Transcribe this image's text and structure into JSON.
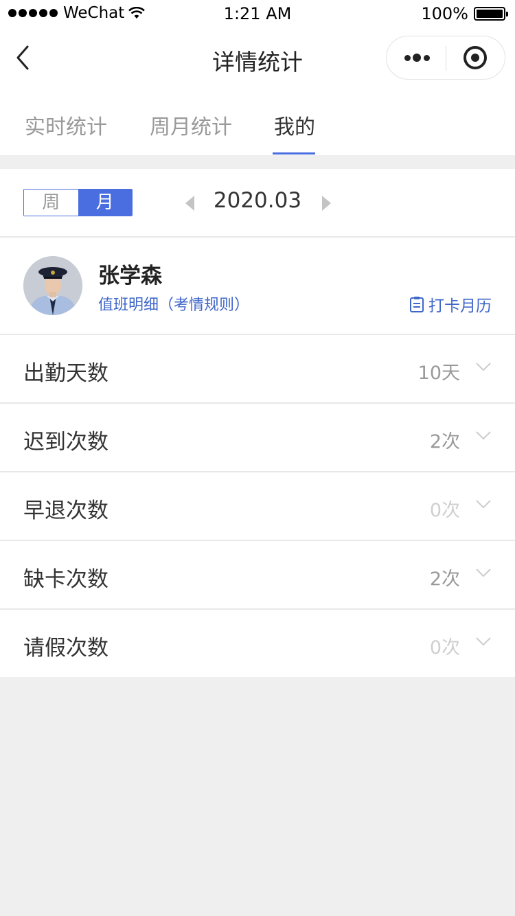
{
  "status_bar": {
    "carrier": "WeChat",
    "time": "1:21 AM",
    "battery": "100%"
  },
  "nav": {
    "title": "详情统计"
  },
  "tabs": [
    {
      "label": "实时统计",
      "active": false
    },
    {
      "label": "周月统计",
      "active": false
    },
    {
      "label": "我的",
      "active": true
    }
  ],
  "period": {
    "week_label": "周",
    "month_label": "月",
    "selected": "月",
    "current": "2020.03"
  },
  "user": {
    "name": "张学森",
    "rules_link": "值班明细（考情规则）",
    "calendar_link": "打卡月历"
  },
  "stats": [
    {
      "label": "出勤天数",
      "value": "10天"
    },
    {
      "label": "迟到次数",
      "value": "2次"
    },
    {
      "label": "早退次数",
      "value": "0次"
    },
    {
      "label": "缺卡次数",
      "value": "2次"
    },
    {
      "label": "请假次数",
      "value": "0次"
    }
  ],
  "colors": {
    "accent": "#4a6ee0",
    "link": "#3f66c9",
    "background": "#efefef"
  }
}
